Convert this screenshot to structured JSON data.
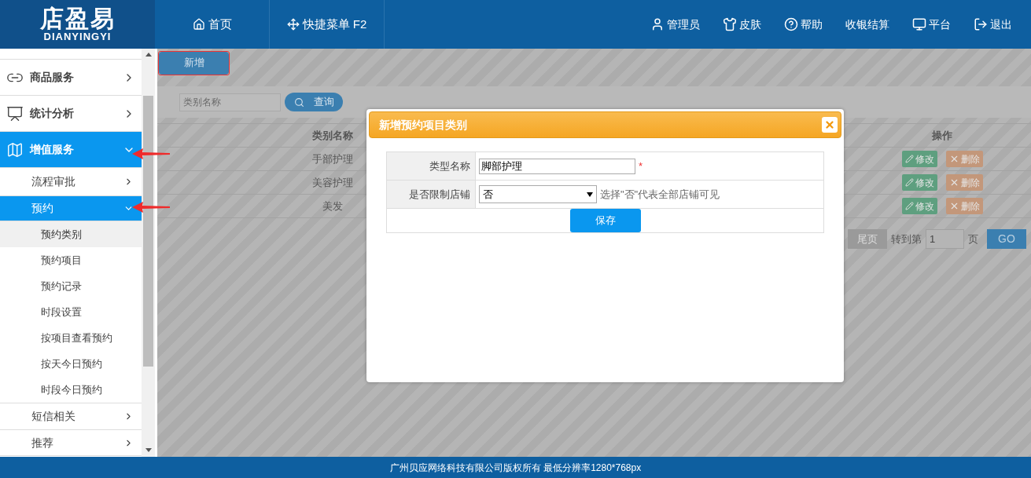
{
  "header": {
    "logo_title": "店盈易",
    "logo_subtitle": "DIANYINGYI",
    "nav": [
      {
        "label": "首页"
      },
      {
        "label": "快捷菜单 F2"
      }
    ],
    "tools": [
      {
        "label": "管理员"
      },
      {
        "label": "皮肤"
      },
      {
        "label": "帮助"
      },
      {
        "label": "收银结算"
      },
      {
        "label": "平台"
      },
      {
        "label": "退出"
      }
    ]
  },
  "sidebar": {
    "items": [
      {
        "label": "商品服务",
        "expanded": false,
        "selected": false
      },
      {
        "label": "统计分析",
        "expanded": false,
        "selected": false
      },
      {
        "label": "增值服务",
        "expanded": true,
        "selected": true,
        "children": [
          {
            "label": "流程审批",
            "expanded": false,
            "selected": false
          },
          {
            "label": "预约",
            "expanded": true,
            "selected": true,
            "children": [
              {
                "label": "预约类别",
                "selected": true
              },
              {
                "label": "预约项目",
                "selected": false
              },
              {
                "label": "预约记录",
                "selected": false
              },
              {
                "label": "时段设置",
                "selected": false
              },
              {
                "label": "按项目查看预约",
                "selected": false
              },
              {
                "label": "按天今日预约",
                "selected": false
              },
              {
                "label": "时段今日预约",
                "selected": false
              }
            ]
          },
          {
            "label": "短信相关",
            "expanded": false,
            "selected": false
          },
          {
            "label": "推荐",
            "expanded": false,
            "selected": false
          }
        ]
      }
    ]
  },
  "toolbar": {
    "add_button": "新增"
  },
  "search": {
    "placeholder": "类别名称",
    "button": "查询"
  },
  "table": {
    "columns": [
      "类别名称",
      "操作"
    ],
    "rows": [
      {
        "name": "手部护理",
        "actions": [
          "修改",
          "删除"
        ]
      },
      {
        "name": "美容护理",
        "actions": [
          "修改",
          "删除"
        ]
      },
      {
        "name": "美发",
        "actions": [
          "修改",
          "删除"
        ]
      }
    ]
  },
  "pager": {
    "last": "尾页",
    "goto_label": "转到第",
    "page_value": "1",
    "page_suffix": "页",
    "go": "GO"
  },
  "modal": {
    "title": "新增预约项目类别",
    "fields": [
      {
        "kind": "text",
        "label": "类型名称",
        "value": "脚部护理",
        "required_mark": "*"
      },
      {
        "kind": "select",
        "label": "是否限制店铺",
        "value": "否",
        "hint": "选择\"否\"代表全部店铺可见"
      }
    ],
    "save": "保存"
  },
  "footer": "广州贝应网络科技有限公司版权所有 最低分辨率1280*768px"
}
